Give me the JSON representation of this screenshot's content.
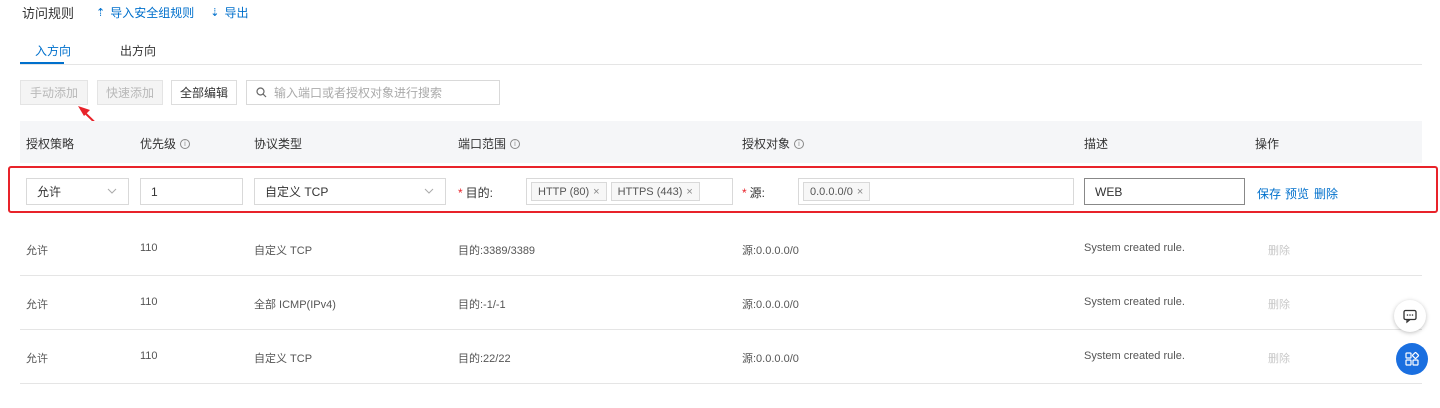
{
  "header": {
    "title": "访问规则",
    "import_label": "导入安全组规则",
    "export_label": "导出"
  },
  "tabs": [
    {
      "label": "入方向",
      "active": true
    },
    {
      "label": "出方向",
      "active": false
    }
  ],
  "toolbar": {
    "manual_add": "手动添加",
    "quick_add": "快速添加",
    "edit_all": "全部编辑",
    "search_placeholder": "输入端口或者授权对象进行搜索"
  },
  "columns": [
    "授权策略",
    "优先级",
    "协议类型",
    "端口范围",
    "授权对象",
    "描述",
    "操作"
  ],
  "edit_row": {
    "policy": "允许",
    "priority": "1",
    "protocol": "自定义 TCP",
    "dest_label": "目的:",
    "dest_tags": [
      "HTTP (80)",
      "HTTPS (443)"
    ],
    "source_label": "源:",
    "source_tags": [
      "0.0.0.0/0"
    ],
    "description": "WEB",
    "actions": [
      "保存",
      "预览",
      "删除"
    ]
  },
  "rows": [
    {
      "policy": "允许",
      "priority": "110",
      "protocol": "自定义 TCP",
      "port": "目的:3389/3389",
      "object": "源:0.0.0.0/0",
      "desc": "System created rule.",
      "action": "删除"
    },
    {
      "policy": "允许",
      "priority": "110",
      "protocol": "全部 ICMP(IPv4)",
      "port": "目的:-1/-1",
      "object": "源:0.0.0.0/0",
      "desc": "System created rule.",
      "action": "删除"
    },
    {
      "policy": "允许",
      "priority": "110",
      "protocol": "自定义 TCP",
      "port": "目的:22/22",
      "object": "源:0.0.0.0/0",
      "desc": "System created rule.",
      "action": "删除"
    }
  ],
  "colors": {
    "accent": "#0070cc",
    "highlight": "#e8232a",
    "fab": "#1a6fe0"
  },
  "icons": [
    "upload-icon",
    "download-icon",
    "search-icon",
    "info-icon",
    "chevron-down-icon",
    "close-icon",
    "chat-icon",
    "apps-icon"
  ]
}
